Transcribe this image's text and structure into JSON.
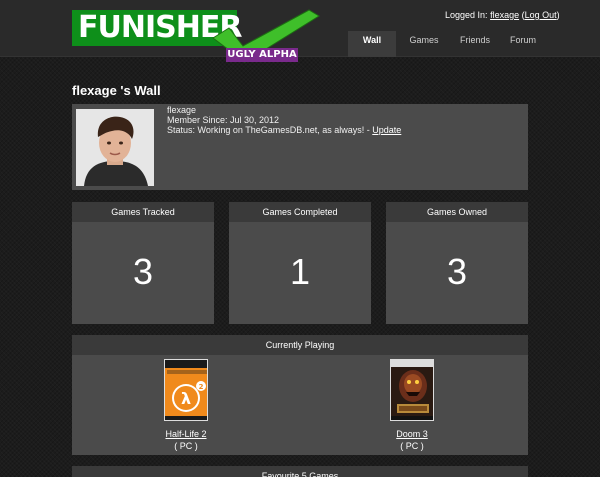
{
  "app": {
    "logo_text": "FUNISHER",
    "logo_tag": "UGLY ALPHA",
    "brand_green": "#0e8f1a",
    "brand_purple": "#7a2a8c",
    "check_green": "#3fbf2a"
  },
  "header": {
    "login_prefix": "Logged In:",
    "username": "flexage",
    "logout_open": "(",
    "logout_label": "Log Out",
    "logout_close": ")"
  },
  "nav": {
    "items": [
      {
        "label": "Wall",
        "active": true
      },
      {
        "label": "Games",
        "active": false
      },
      {
        "label": "Friends",
        "active": false
      },
      {
        "label": "Forum",
        "active": false
      }
    ]
  },
  "wall": {
    "title": "flexage 's Wall",
    "profile": {
      "name": "flexage",
      "member_since": "Member Since: Jul 30, 2012",
      "status_prefix": "Status: Working on TheGamesDB.net, as always! -",
      "update_label": "Update"
    }
  },
  "stats": [
    {
      "label": "Games Tracked",
      "value": "3"
    },
    {
      "label": "Games Completed",
      "value": "1"
    },
    {
      "label": "Games Owned",
      "value": "3"
    }
  ],
  "currently_playing": {
    "heading": "Currently Playing",
    "games": [
      {
        "title": "Half-Life 2",
        "platform": "( PC )",
        "cover_icon": "half-life-2-cover"
      },
      {
        "title": "Doom 3",
        "platform": "( PC )",
        "cover_icon": "doom-3-cover"
      }
    ]
  },
  "favourites": {
    "heading": "Favourite 5 Games"
  }
}
